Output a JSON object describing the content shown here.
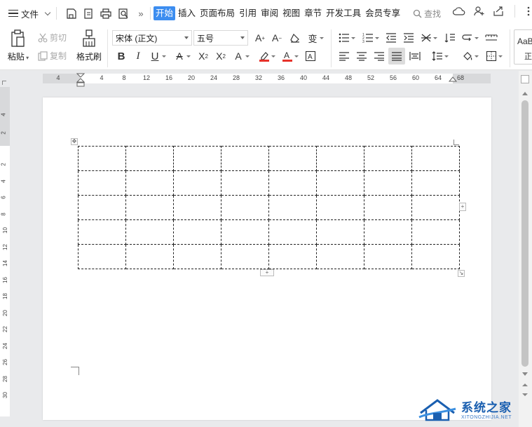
{
  "menubar": {
    "file_label": "文件",
    "tabs": [
      {
        "label": "开始",
        "active": true
      },
      {
        "label": "插入",
        "active": false
      },
      {
        "label": "页面布局",
        "active": false
      },
      {
        "label": "引用",
        "active": false
      },
      {
        "label": "审阅",
        "active": false
      },
      {
        "label": "视图",
        "active": false
      },
      {
        "label": "章节",
        "active": false
      },
      {
        "label": "开发工具",
        "active": false
      },
      {
        "label": "会员专享",
        "active": false
      }
    ],
    "search_label": "查找",
    "accent_color": "#3c8df0"
  },
  "ribbon": {
    "paste_label": "粘贴",
    "cut_label": "剪切",
    "copy_label": "复制",
    "format_painter_label": "格式刷",
    "font_name": "宋体 (正文)",
    "font_size": "五号",
    "style_preview": "AaBl",
    "style_sub": "正"
  },
  "ruler": {
    "h_ticks": [
      "4",
      "4",
      "8",
      "12",
      "16",
      "20",
      "24",
      "28",
      "32",
      "36",
      "40",
      "44",
      "48",
      "52",
      "56",
      "60",
      "64",
      "68"
    ],
    "v_ticks": [
      "4",
      "2",
      "2",
      "4",
      "6",
      "8",
      "10",
      "12",
      "14",
      "16",
      "18",
      "20",
      "22",
      "24",
      "26",
      "28",
      "30"
    ]
  },
  "table": {
    "rows": 5,
    "cols": 8
  },
  "watermark": {
    "title": "系统之家",
    "subtitle": "XITONGZHIJIA.NET"
  }
}
